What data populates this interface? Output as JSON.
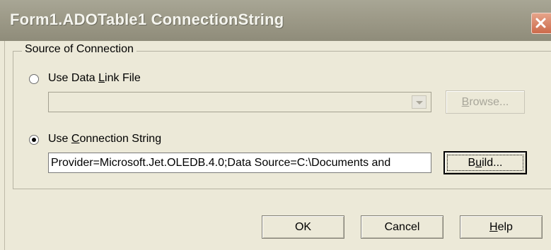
{
  "window": {
    "title": "Form1.ADOTable1 ConnectionString"
  },
  "group": {
    "legend": "Source of Connection"
  },
  "data_link": {
    "label_before": "Use Data ",
    "label_mnemonic": "L",
    "label_after": "ink File",
    "selected": false,
    "combo_value": "",
    "browse_before": "",
    "browse_mnemonic": "B",
    "browse_after": "rowse..."
  },
  "conn_string": {
    "label_before": "Use ",
    "label_mnemonic": "C",
    "label_after": "onnection String",
    "selected": true,
    "value": "Provider=Microsoft.Jet.OLEDB.4.0;Data Source=C:\\Documents and",
    "build_before": "B",
    "build_mnemonic": "u",
    "build_after": "ild..."
  },
  "buttons": {
    "ok": "OK",
    "cancel": "Cancel",
    "help_mnemonic": "H",
    "help_after": "elp"
  }
}
